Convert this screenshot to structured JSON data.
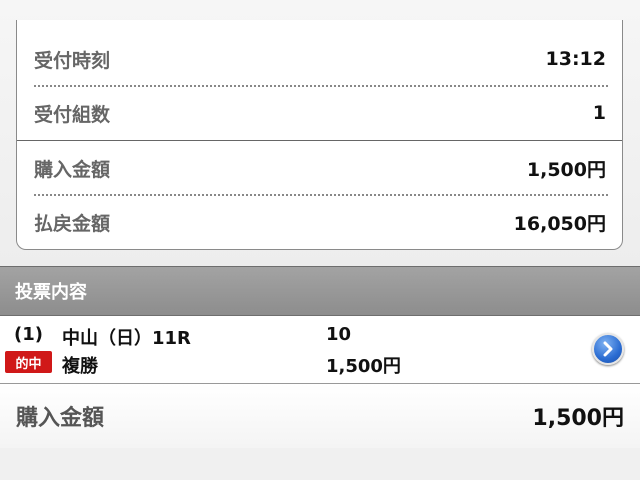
{
  "summary": {
    "time_label": "受付時刻",
    "time_value": "13:12",
    "groups_label": "受付組数",
    "groups_value": "1",
    "purchase_label": "購入金額",
    "purchase_value": "1,500円",
    "payout_label": "払戻金額",
    "payout_value": "16,050円"
  },
  "section": {
    "title": "投票内容"
  },
  "bet": {
    "index": "(1)",
    "race": "中山（日）11R",
    "selection": "10",
    "badge": "的中",
    "type": "複勝",
    "amount": "1,500円",
    "detail_icon": "chevron-right-circle-icon"
  },
  "total": {
    "label": "購入金額",
    "value": "1,500円"
  },
  "colors": {
    "hit_badge": "#d01818",
    "header_bg": "#999999",
    "arrow_button": "#2a6cd2"
  }
}
